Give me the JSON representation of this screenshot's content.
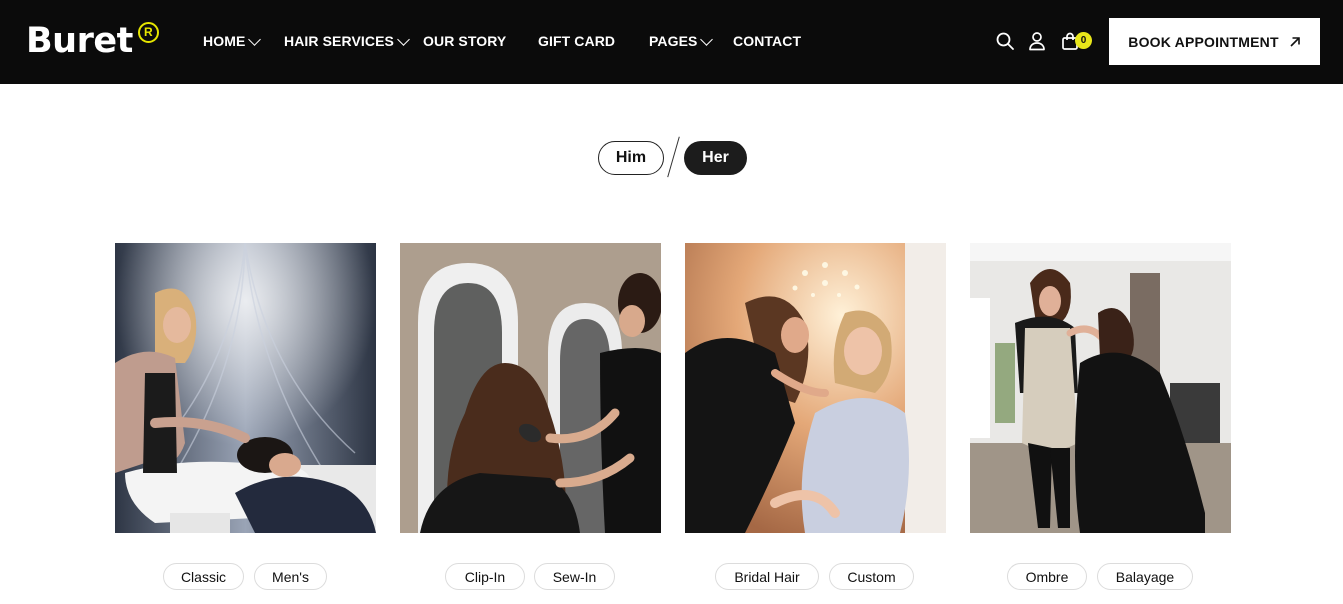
{
  "brand": {
    "name": "Buret",
    "reg_mark": "R"
  },
  "nav": {
    "items": [
      {
        "label": "HOME",
        "has_dropdown": true
      },
      {
        "label": "HAIR SERVICES",
        "has_dropdown": true
      },
      {
        "label": "OUR STORY",
        "has_dropdown": false
      },
      {
        "label": "GIFT CARD",
        "has_dropdown": false
      },
      {
        "label": "PAGES",
        "has_dropdown": true
      },
      {
        "label": "CONTACT",
        "has_dropdown": false
      }
    ]
  },
  "header_icons": {
    "search": "search-icon",
    "account": "user-icon",
    "cart": "shopping-bag-icon"
  },
  "cart": {
    "count": "0"
  },
  "cta": {
    "label": "BOOK APPOINTMENT",
    "icon": "arrow-up-right-icon"
  },
  "tabs": {
    "him": "Him",
    "her": "Her",
    "active": "Her"
  },
  "cards": [
    {
      "image": "hair-wash-photo",
      "tags": [
        "Classic",
        "Men's"
      ]
    },
    {
      "image": "hair-extension-photo",
      "tags": [
        "Clip-In",
        "Sew-In"
      ]
    },
    {
      "image": "bridal-makeup-photo",
      "tags": [
        "Bridal Hair",
        "Custom"
      ]
    },
    {
      "image": "hair-curling-photo",
      "tags": [
        "Ombre",
        "Balayage"
      ]
    }
  ],
  "colors": {
    "header_bg": "#0b0b0b",
    "accent": "#e8e61a",
    "dark_pill": "#1c1c1c"
  }
}
